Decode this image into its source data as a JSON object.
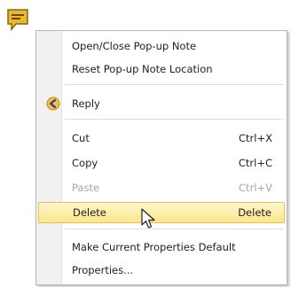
{
  "icons": {
    "note": "popup-note-icon",
    "reply": "reply-icon",
    "cursor": "mouse-pointer-icon"
  },
  "colors": {
    "note_fill": "#e8b830",
    "highlight": "#ffe58a"
  },
  "menu": {
    "items": [
      {
        "label": "Open/Close Pop-up Note",
        "shortcut": ""
      },
      {
        "label": "Reset Pop-up Note Location",
        "shortcut": ""
      },
      {
        "label": "Reply",
        "shortcut": ""
      },
      {
        "label": "Cut",
        "shortcut": "Ctrl+X"
      },
      {
        "label": "Copy",
        "shortcut": "Ctrl+C"
      },
      {
        "label": "Paste",
        "shortcut": "Ctrl+V",
        "disabled": true
      },
      {
        "label": "Delete",
        "shortcut": "Delete",
        "highlighted": true
      },
      {
        "label": "Make Current Properties Default",
        "shortcut": ""
      },
      {
        "label": "Properties...",
        "shortcut": ""
      }
    ]
  }
}
